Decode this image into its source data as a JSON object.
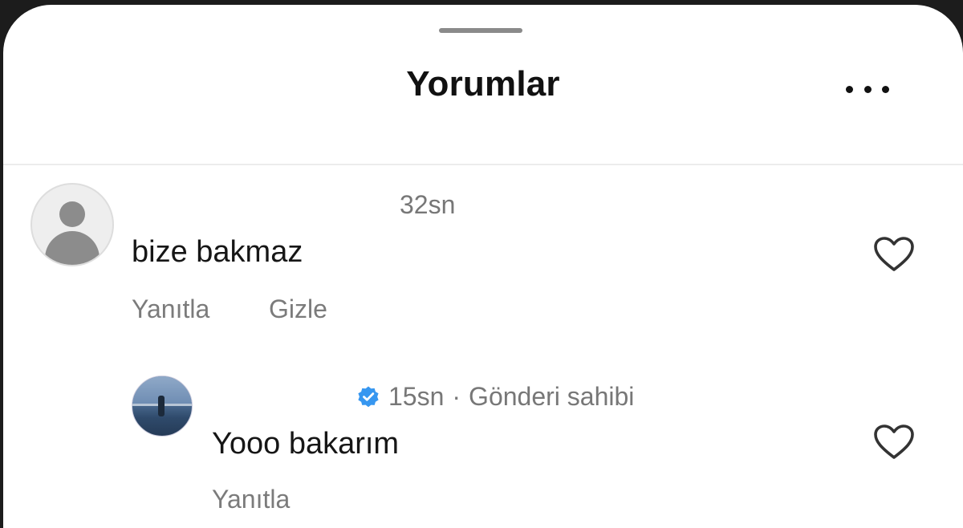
{
  "header": {
    "title": "Yorumlar",
    "more_icon": "more-horizontal-icon"
  },
  "comments": [
    {
      "avatar": "default-profile-icon",
      "time": "32sn",
      "text": "bize bakmaz",
      "actions": [
        "Yanıtla",
        "Gizle"
      ],
      "like_icon": "heart-outline-icon"
    }
  ],
  "replies": [
    {
      "avatar": "profile-photo",
      "verified_icon": "verified-badge-icon",
      "time": "15sn",
      "meta_separator": "·",
      "author_label": "Gönderi sahibi",
      "text": "Yooo bakarım",
      "actions": [
        "Yanıtla"
      ],
      "like_icon": "heart-outline-icon"
    }
  ],
  "colors": {
    "background": "#ffffff",
    "text_primary": "#161616",
    "text_secondary": "#777777",
    "verified_blue": "#3797f0",
    "divider": "#ececec"
  }
}
